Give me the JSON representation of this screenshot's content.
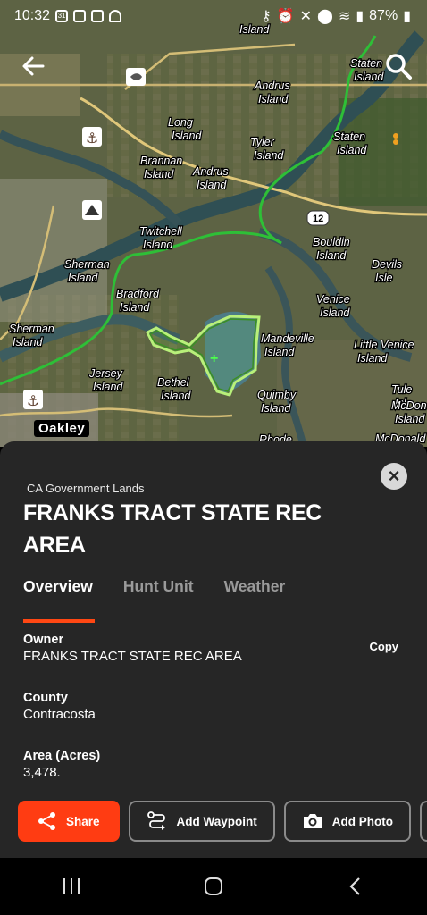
{
  "status_bar": {
    "time": "10:32",
    "date_badge": "31",
    "battery": "87%"
  },
  "map": {
    "labels": [
      "Island",
      "Staten Island",
      "Andrus Island",
      "Long Island",
      "Tyler Island",
      "Staten Island",
      "Brannan Island",
      "Andrus Island",
      "Twitchell Island",
      "Bouldin Island",
      "Devils Isle",
      "Sherman Island",
      "Bradford Island",
      "Venice Island",
      "Sherman Island",
      "Mandeville Island",
      "Little Venice Island",
      "Jersey Island",
      "Bethel Island",
      "Quimby Island",
      "Tule Isl",
      "McDona Island",
      "McDonald",
      "Rhode"
    ],
    "highway": "12",
    "city": "Oakley"
  },
  "sheet": {
    "subtitle": "CA Government Lands",
    "title": "FRANKS TRACT STATE REC AREA",
    "tabs": [
      "Overview",
      "Hunt Unit",
      "Weather"
    ],
    "owner_label": "Owner",
    "owner_value": "FRANKS TRACT STATE REC AREA",
    "copy_label": "Copy",
    "county_label": "County",
    "county_value": "Contracosta",
    "area_label": "Area (Acres)",
    "area_value": "3,478.",
    "actions": {
      "share": "Share",
      "waypoint": "Add Waypoint",
      "photo": "Add Photo"
    }
  }
}
